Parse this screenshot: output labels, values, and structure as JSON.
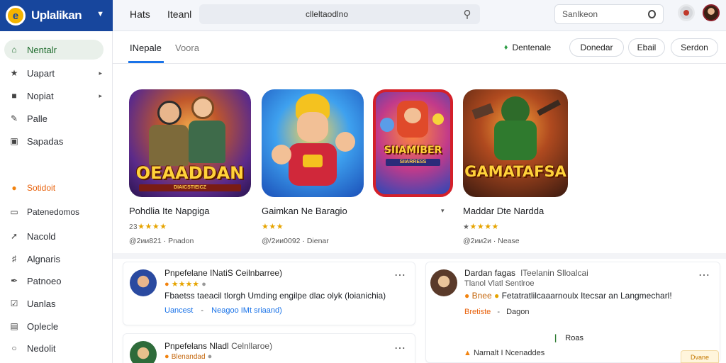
{
  "brand": {
    "name": "Uplalikan",
    "logo_letter": "e"
  },
  "topnav": {
    "item1": "Hats",
    "item2": "Iteanl"
  },
  "search": {
    "value": "clleltaodlno",
    "icon": "search-icon"
  },
  "mini_search": {
    "placeholder": "Sanlkeon"
  },
  "sidebar": {
    "items": [
      {
        "label": "Nentalr",
        "icon": "home-icon",
        "active": true
      },
      {
        "label": "Uapart",
        "icon": "star-icon",
        "chevron": true
      },
      {
        "label": "Nopiat",
        "icon": "folder-icon",
        "chevron": true
      },
      {
        "label": "Palle",
        "icon": "edit-icon"
      },
      {
        "label": "Sapadas",
        "icon": "box-icon"
      },
      {
        "label": "Sotidoit",
        "icon": "dot-icon",
        "accent": true
      },
      {
        "label": "Patenedomos",
        "icon": "window-icon"
      },
      {
        "label": "Nacold",
        "icon": "arrow-icon"
      },
      {
        "label": "Algnaris",
        "icon": "tag-icon"
      },
      {
        "label": "Patnoeo",
        "icon": "pen-icon"
      },
      {
        "label": "Uanlas",
        "icon": "check-box-icon"
      },
      {
        "label": "Oplecle",
        "icon": "doc-icon"
      },
      {
        "label": "Nedolit",
        "icon": "circle-icon"
      }
    ]
  },
  "tabs": [
    {
      "label": "INepale"
    },
    {
      "label": "Voora"
    }
  ],
  "toolbar": {
    "dentenale": "Dentenale",
    "donedar": "Donedar",
    "ebail": "Ebail",
    "serdon": "Serdon"
  },
  "games": [
    {
      "name": "Pohdlia Ite Napgiga",
      "art_title": "OEAADDAN",
      "art_sub": "DIAICSTIEICZ",
      "rating_prefix": "23",
      "stars": "★★★★",
      "meta": "@2ии821 · Pnadon"
    },
    {
      "name": "Gaimkan Ne Baragio",
      "art_title": "",
      "art_sub": "",
      "rating_prefix": "",
      "stars": "★★★",
      "meta": "@/2ии0092 · Dienar"
    },
    {
      "name": "",
      "art_title": "SIIAMIBER",
      "art_sub": "SIIARRESS",
      "rating_prefix": "",
      "stars": "",
      "meta": ""
    },
    {
      "name": "Maddar Dte Nardda",
      "art_title": "GAMATAFSA",
      "art_sub": "",
      "rating_prefix": "★",
      "stars": "★★★★",
      "meta": "@2ии2и · Nease"
    }
  ],
  "reviews": [
    {
      "name": "Pnpefelane INatiS Ceilnbarree)",
      "stars": "★★★★",
      "text": "Fbaetss taeacil tlorgh Umding engilpe dlac olyk (loianichia)",
      "link1": "Uancest",
      "link2": "Neagoo IMt sriaand)"
    },
    {
      "name": "Dardan fagas",
      "name_extra": "lTeelanin Slloalcai",
      "stars_text": "Tlanol Vlatl Sentlroe",
      "text_badge": "Bnee",
      "text": "Fetatratlilcaaarnoulx Itecsar an Langmecharl!",
      "link1": "Bretiste",
      "link2": "Dagon",
      "footer": "Roas"
    },
    {
      "name": "Pnpefelans Nladl",
      "name_extra": "Celnllaroe)",
      "badge": "Blenandad",
      "second_label": "Narnalt I Ncenaddes",
      "chip": "Dvane"
    }
  ],
  "colors": {
    "brand_blue": "#17469d",
    "accent_orange": "#f2830f",
    "star": "#e6a400",
    "link_blue": "#1a73e8"
  }
}
